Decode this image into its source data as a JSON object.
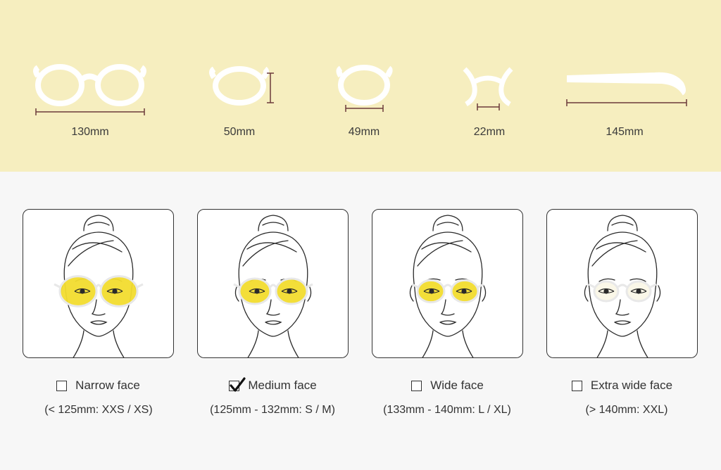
{
  "measurements": [
    {
      "name": "total-width",
      "label": "130mm"
    },
    {
      "name": "lens-height",
      "label": "50mm"
    },
    {
      "name": "lens-width",
      "label": "49mm"
    },
    {
      "name": "bridge-width",
      "label": "22mm"
    },
    {
      "name": "temple-length",
      "label": "145mm"
    }
  ],
  "colors": {
    "top_background": "#f6eebf",
    "lens_yellow": "#f2dc2e",
    "frame": "#ffffff",
    "dimension_line": "#6b3a3a"
  },
  "options": [
    {
      "label": "Narrow face",
      "range": "(< 125mm: XXS / XS)",
      "checked": false
    },
    {
      "label": "Medium face",
      "range": "(125mm - 132mm: S / M)",
      "checked": true
    },
    {
      "label": "Wide face",
      "range": "(133mm - 140mm: L / XL)",
      "checked": false
    },
    {
      "label": "Extra wide face",
      "range": "(> 140mm: XXL)",
      "checked": false
    }
  ]
}
